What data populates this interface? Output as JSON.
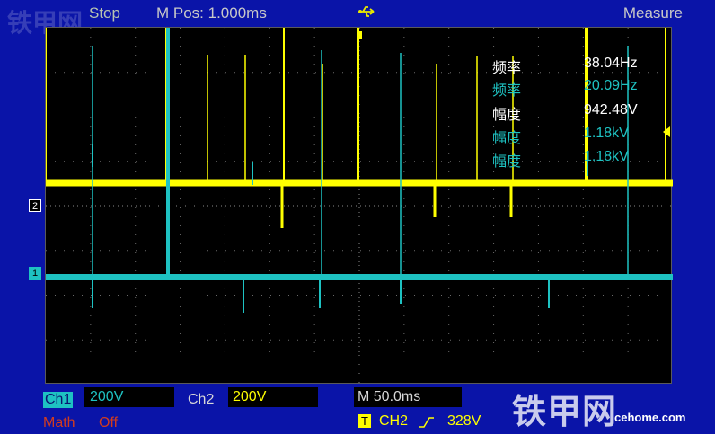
{
  "header": {
    "watermark_left": "铁甲网",
    "status": "Stop",
    "mpos": "M Pos: 1.000ms",
    "usb_icon": "usb-icon",
    "measure_title": "Measure"
  },
  "measurements": [
    {
      "label": "频率",
      "value": "38.04Hz",
      "channel": "CH2"
    },
    {
      "label": "频率",
      "value": "20.09Hz",
      "channel": "CH1"
    },
    {
      "label": "幅度",
      "value": "942.48V",
      "channel": "CH2"
    },
    {
      "label": "幅度",
      "value": "1.18kV",
      "channel": "CH1"
    },
    {
      "label": "幅度",
      "value": "1.18kV",
      "channel": "CH1"
    }
  ],
  "channels": {
    "ch1": {
      "label": "Ch1",
      "scale": "200V",
      "marker": "1",
      "color": "#1ec2c2"
    },
    "ch2": {
      "label": "Ch2",
      "scale": "200V",
      "marker": "2",
      "color": "#ffff00"
    },
    "math": {
      "label": "Math",
      "state": "Off",
      "color": "#d23c1e"
    }
  },
  "timebase": {
    "label": "M 50.0ms"
  },
  "trigger": {
    "icon": "T",
    "source": "CH2",
    "slope_icon": "rising-edge-icon",
    "level": "328V"
  },
  "watermark": {
    "text": "铁甲网",
    "site": "cehome.com"
  }
}
